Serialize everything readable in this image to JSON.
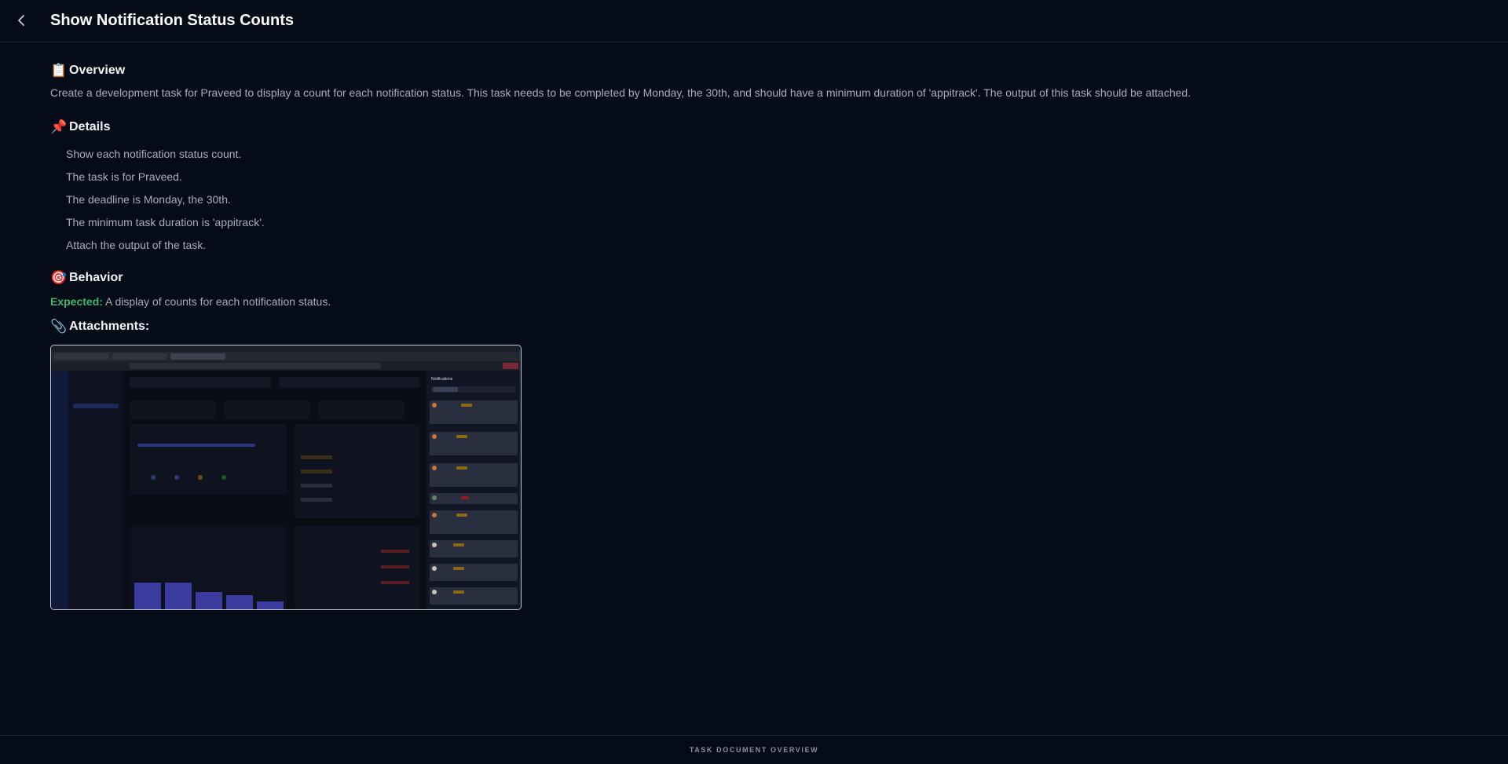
{
  "header": {
    "title": "Show Notification Status Counts"
  },
  "overview": {
    "heading": "Overview",
    "text": "Create a development task for Praveed to display a count for each notification status. This task needs to be completed by Monday, the 30th, and should have a minimum duration of 'appitrack'. The output of this task should be attached."
  },
  "details": {
    "heading": "Details",
    "items": [
      "Show each notification status count.",
      "The task is for Praveed.",
      "The deadline is Monday, the 30th.",
      "The minimum task duration is 'appitrack'.",
      "Attach the output of the task."
    ]
  },
  "behavior": {
    "heading": "Behavior",
    "expected_label": "Expected:",
    "expected_text": "A display of counts for each notification status."
  },
  "attachments": {
    "heading": "Attachments:",
    "screenshot_panel_title": "Notifications"
  },
  "footer": {
    "label": "TASK DOCUMENT OVERVIEW"
  },
  "icons": {
    "back": "chevron-left-icon",
    "overview": "clipboard-icon",
    "details": "pushpin-icon",
    "behavior": "target-icon",
    "attachments": "paperclip-icon"
  },
  "colors": {
    "background": "#060b18",
    "expected_green": "#3fb86d",
    "border": "#1c2233"
  }
}
